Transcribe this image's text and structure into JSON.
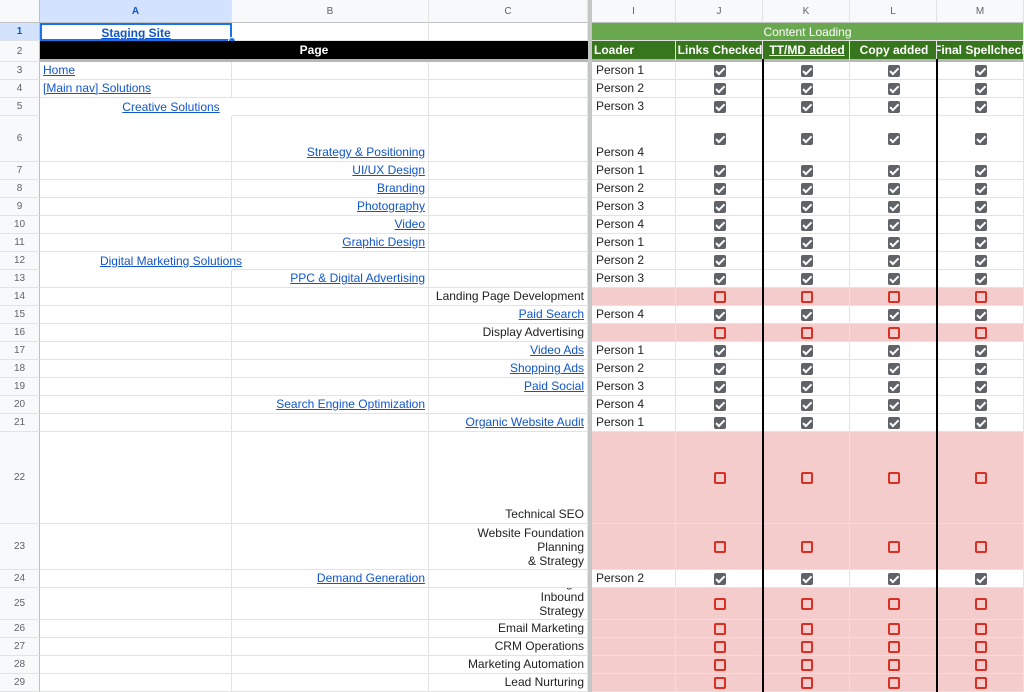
{
  "columns": [
    "A",
    "B",
    "C",
    "I",
    "J",
    "K",
    "L",
    "M"
  ],
  "header_row1": {
    "staging_site": "Staging Site",
    "content_loading": "Content Loading"
  },
  "header_row2": {
    "page": "Page",
    "loader": "Loader",
    "links_checked": "Links Checked",
    "ttmd_added": "TT/MD added",
    "copy_added": "Copy added",
    "final_spellcheck": "Final Spellcheck"
  },
  "rows": [
    {
      "n": "3",
      "col": "A",
      "text": "Home",
      "link": true,
      "loader": "Person 1",
      "checks": [
        true,
        true,
        true,
        true
      ],
      "pink": false
    },
    {
      "n": "4",
      "col": "A",
      "text": "[Main nav] Solutions",
      "link": true,
      "loader": "Person 2",
      "checks": [
        true,
        true,
        true,
        true
      ],
      "pink": false
    },
    {
      "n": "5",
      "col": "A",
      "text": "Creative Solutions",
      "link": true,
      "loader": "Person 3",
      "checks": [
        true,
        true,
        true,
        true
      ],
      "pink": false
    },
    {
      "n": "6",
      "col": "B",
      "text": "Strategy & Positioning",
      "link": true,
      "loader": "Person 4",
      "checks": [
        true,
        true,
        true,
        true
      ],
      "pink": false
    },
    {
      "n": "7",
      "col": "B",
      "text": "UI/UX Design",
      "link": true,
      "loader": "Person 1",
      "checks": [
        true,
        true,
        true,
        true
      ],
      "pink": false
    },
    {
      "n": "8",
      "col": "B",
      "text": "Branding",
      "link": true,
      "loader": "Person 2",
      "checks": [
        true,
        true,
        true,
        true
      ],
      "pink": false
    },
    {
      "n": "9",
      "col": "B",
      "text": "Photography",
      "link": true,
      "loader": "Person 3",
      "checks": [
        true,
        true,
        true,
        true
      ],
      "pink": false
    },
    {
      "n": "10",
      "col": "B",
      "text": "Video",
      "link": true,
      "loader": "Person 4",
      "checks": [
        true,
        true,
        true,
        true
      ],
      "pink": false
    },
    {
      "n": "11",
      "col": "B",
      "text": "Graphic Design",
      "link": true,
      "loader": "Person 1",
      "checks": [
        true,
        true,
        true,
        true
      ],
      "pink": false
    },
    {
      "n": "12",
      "col": "A",
      "text": "Digital Marketing Solutions",
      "link": true,
      "loader": "Person 2",
      "checks": [
        true,
        true,
        true,
        true
      ],
      "pink": false
    },
    {
      "n": "13",
      "col": "B",
      "text": "PPC & Digital Advertising",
      "link": true,
      "loader": "Person 3",
      "checks": [
        true,
        true,
        true,
        true
      ],
      "pink": false
    },
    {
      "n": "14",
      "col": "C",
      "text": "Landing Page Development",
      "link": false,
      "loader": "",
      "checks": [
        false,
        false,
        false,
        false
      ],
      "pink": true
    },
    {
      "n": "15",
      "col": "C",
      "text": "Paid Search",
      "link": true,
      "loader": "Person 4",
      "checks": [
        true,
        true,
        true,
        true
      ],
      "pink": false
    },
    {
      "n": "16",
      "col": "C",
      "text": "Display Advertising",
      "link": false,
      "loader": "",
      "checks": [
        false,
        false,
        false,
        false
      ],
      "pink": true
    },
    {
      "n": "17",
      "col": "C",
      "text": "Video Ads",
      "link": true,
      "loader": "Person 1",
      "checks": [
        true,
        true,
        true,
        true
      ],
      "pink": false
    },
    {
      "n": "18",
      "col": "C",
      "text": "Shopping Ads",
      "link": true,
      "loader": "Person 2",
      "checks": [
        true,
        true,
        true,
        true
      ],
      "pink": false
    },
    {
      "n": "19",
      "col": "C",
      "text": "Paid Social",
      "link": true,
      "loader": "Person 3",
      "checks": [
        true,
        true,
        true,
        true
      ],
      "pink": false
    },
    {
      "n": "20",
      "col": "B",
      "text": "Search Engine Optimization",
      "link": true,
      "loader": "Person 4",
      "checks": [
        true,
        true,
        true,
        true
      ],
      "pink": false
    },
    {
      "n": "21",
      "col": "C",
      "text": "Organic Website Audit",
      "link": true,
      "loader": "Person 1",
      "checks": [
        true,
        true,
        true,
        true
      ],
      "pink": false
    },
    {
      "n": "22",
      "col": "C",
      "text": "Technical SEO",
      "link": false,
      "loader": "",
      "checks": [
        false,
        false,
        false,
        false
      ],
      "pink": true
    },
    {
      "n": "23",
      "col": "C",
      "text": "Website Foundation Planning\n& Strategy",
      "link": false,
      "loader": "",
      "checks": [
        false,
        false,
        false,
        false
      ],
      "pink": true
    },
    {
      "n": "24",
      "col": "B",
      "text": "Demand Generation",
      "link": true,
      "loader": "Person 2",
      "checks": [
        true,
        true,
        true,
        true
      ],
      "pink": false
    },
    {
      "n": "25",
      "col": "C",
      "text": "Content Marketing & Inbound\nStrategy",
      "link": false,
      "loader": "",
      "checks": [
        false,
        false,
        false,
        false
      ],
      "pink": true
    },
    {
      "n": "26",
      "col": "C",
      "text": "Email Marketing",
      "link": false,
      "loader": "",
      "checks": [
        false,
        false,
        false,
        false
      ],
      "pink": true
    },
    {
      "n": "27",
      "col": "C",
      "text": "CRM Operations",
      "link": false,
      "loader": "",
      "checks": [
        false,
        false,
        false,
        false
      ],
      "pink": true
    },
    {
      "n": "28",
      "col": "C",
      "text": "Marketing Automation",
      "link": false,
      "loader": "",
      "checks": [
        false,
        false,
        false,
        false
      ],
      "pink": true
    },
    {
      "n": "29",
      "col": "C",
      "text": "Lead Nurturing",
      "link": false,
      "loader": "",
      "checks": [
        false,
        false,
        false,
        false
      ],
      "pink": true
    }
  ],
  "colors": {
    "dark_green": "#38761d",
    "light_green": "#6aa84f",
    "pink": "#f4cccc",
    "link": "#1155cc",
    "checked": "#5f6368",
    "unchecked": "#d93025"
  }
}
